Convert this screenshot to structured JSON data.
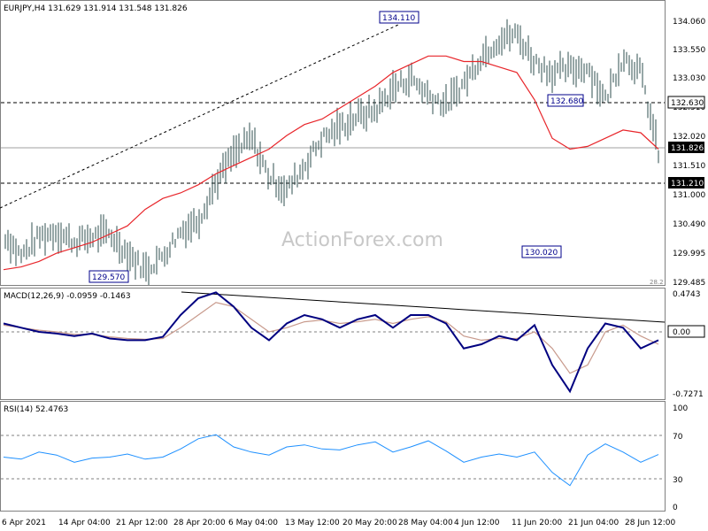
{
  "price_panel": {
    "header": "EURJPY,H4  131.629 131.914 131.548 131.826",
    "watermark": "ActionForex.com",
    "y_axis_labels": [
      "134.060",
      "133.550",
      "133.030",
      "132.510",
      "132.020",
      "131.510",
      "131.000",
      "130.490",
      "129.995",
      "129.485"
    ],
    "current_price_tag": "131.826",
    "level_tags": [
      "132.630",
      "131.210"
    ],
    "annotations": [
      "134.110",
      "132.680",
      "129.570",
      "130.020"
    ],
    "clipped_label": "28.2"
  },
  "macd_panel": {
    "header": "MACD(12,26,9) -0.0959 -0.1463",
    "y_axis_labels": [
      "0.4743",
      "0.00",
      "-0.7271"
    ]
  },
  "rsi_panel": {
    "header": "RSI(14) 52.4763",
    "y_axis_labels": [
      "100",
      "70",
      "30",
      "0"
    ]
  },
  "x_axis_labels": [
    "6 Apr 2021",
    "14 Apr 04:00",
    "21 Apr 12:00",
    "28 Apr 20:00",
    "6 May 04:00",
    "13 May 12:00",
    "20 May 20:00",
    "28 May 04:00",
    "4 Jun 12:00",
    "11 Jun 20:00",
    "21 Jun 04:00",
    "28 Jun 12:00"
  ],
  "colors": {
    "price_bars": "#2f4f4f",
    "moving_average": "#e8262b",
    "macd_line": "#000080",
    "macd_signal": "#c89a8c",
    "rsi_line": "#1e90ff",
    "levels": "#000000"
  },
  "chart_data": [
    {
      "type": "line",
      "name": "price",
      "x_labels": [
        "6 Apr 2021",
        "14 Apr 04:00",
        "21 Apr 12:00",
        "28 Apr 20:00",
        "6 May 04:00",
        "13 May 12:00",
        "20 May 20:00",
        "28 May 04:00",
        "4 Jun 12:00",
        "11 Jun 20:00",
        "21 Jun 04:00",
        "28 Jun 12:00"
      ],
      "x": [
        0,
        20,
        40,
        60,
        80,
        100,
        120,
        140,
        160,
        180,
        200,
        220,
        240,
        260,
        280,
        300,
        320,
        340,
        360,
        380,
        400,
        420,
        440,
        460,
        480,
        500,
        520,
        540,
        560,
        580,
        600,
        620,
        640,
        660,
        680,
        700,
        720,
        740
      ],
      "series": [
        {
          "name": "close",
          "values": [
            130.35,
            129.95,
            130.3,
            130.4,
            130.2,
            130.3,
            130.35,
            130.0,
            129.7,
            129.95,
            130.4,
            130.6,
            131.3,
            131.8,
            132.1,
            131.4,
            131.15,
            131.6,
            132.1,
            132.3,
            132.5,
            132.6,
            133.0,
            133.2,
            132.9,
            132.7,
            133.1,
            133.6,
            133.9,
            134.0,
            133.5,
            133.3,
            133.35,
            133.4,
            132.8,
            133.6,
            133.3,
            131.83
          ]
        },
        {
          "name": "moving average",
          "values": [
            129.7,
            129.75,
            129.85,
            130.0,
            130.1,
            130.2,
            130.35,
            130.5,
            130.8,
            131.0,
            131.1,
            131.25,
            131.45,
            131.6,
            131.75,
            131.9,
            132.15,
            132.35,
            132.45,
            132.65,
            132.85,
            133.05,
            133.3,
            133.45,
            133.6,
            133.6,
            133.5,
            133.5,
            133.4,
            133.3,
            132.8,
            132.1,
            131.9,
            131.95,
            132.1,
            132.25,
            132.2,
            131.9
          ]
        }
      ],
      "levels": [
        132.63,
        131.21
      ],
      "ylim": [
        129.485,
        134.3
      ]
    },
    {
      "type": "line",
      "name": "MACD(12,26,9)",
      "x": [
        0,
        20,
        40,
        60,
        80,
        100,
        120,
        140,
        160,
        180,
        200,
        220,
        240,
        260,
        280,
        300,
        320,
        340,
        360,
        380,
        400,
        420,
        440,
        460,
        480,
        500,
        520,
        540,
        560,
        580,
        600,
        620,
        640,
        660,
        680,
        700,
        720,
        740
      ],
      "series": [
        {
          "name": "macd",
          "values": [
            0.1,
            0.05,
            0.0,
            -0.02,
            -0.05,
            -0.02,
            -0.08,
            -0.1,
            -0.1,
            -0.06,
            0.2,
            0.4,
            0.47,
            0.3,
            0.05,
            -0.1,
            0.1,
            0.2,
            0.15,
            0.05,
            0.15,
            0.2,
            0.05,
            0.2,
            0.2,
            0.1,
            -0.2,
            -0.15,
            -0.05,
            -0.1,
            0.08,
            -0.4,
            -0.72,
            -0.2,
            0.1,
            0.05,
            -0.2,
            -0.1
          ]
        },
        {
          "name": "signal",
          "values": [
            0.08,
            0.05,
            0.02,
            0.0,
            -0.03,
            -0.03,
            -0.06,
            -0.08,
            -0.09,
            -0.08,
            0.05,
            0.2,
            0.35,
            0.3,
            0.15,
            0.0,
            0.05,
            0.12,
            0.14,
            0.1,
            0.12,
            0.15,
            0.1,
            0.15,
            0.18,
            0.12,
            -0.05,
            -0.1,
            -0.08,
            -0.08,
            0.0,
            -0.2,
            -0.5,
            -0.4,
            0.0,
            0.08,
            -0.05,
            -0.15
          ]
        }
      ],
      "ylim": [
        -0.8,
        0.55
      ]
    },
    {
      "type": "line",
      "name": "RSI(14)",
      "x": [
        0,
        20,
        40,
        60,
        80,
        100,
        120,
        140,
        160,
        180,
        200,
        220,
        240,
        260,
        280,
        300,
        320,
        340,
        360,
        380,
        400,
        420,
        440,
        460,
        480,
        500,
        520,
        540,
        560,
        580,
        600,
        620,
        640,
        660,
        680,
        700,
        720,
        740
      ],
      "series": [
        {
          "name": "rsi",
          "values": [
            50,
            48,
            55,
            52,
            45,
            49,
            50,
            53,
            48,
            50,
            58,
            68,
            72,
            60,
            55,
            52,
            60,
            62,
            58,
            57,
            62,
            65,
            55,
            60,
            66,
            56,
            45,
            50,
            53,
            50,
            55,
            35,
            22,
            52,
            63,
            55,
            45,
            52.5
          ]
        }
      ],
      "ylim": [
        0,
        100
      ],
      "levels": [
        70,
        30
      ]
    }
  ]
}
